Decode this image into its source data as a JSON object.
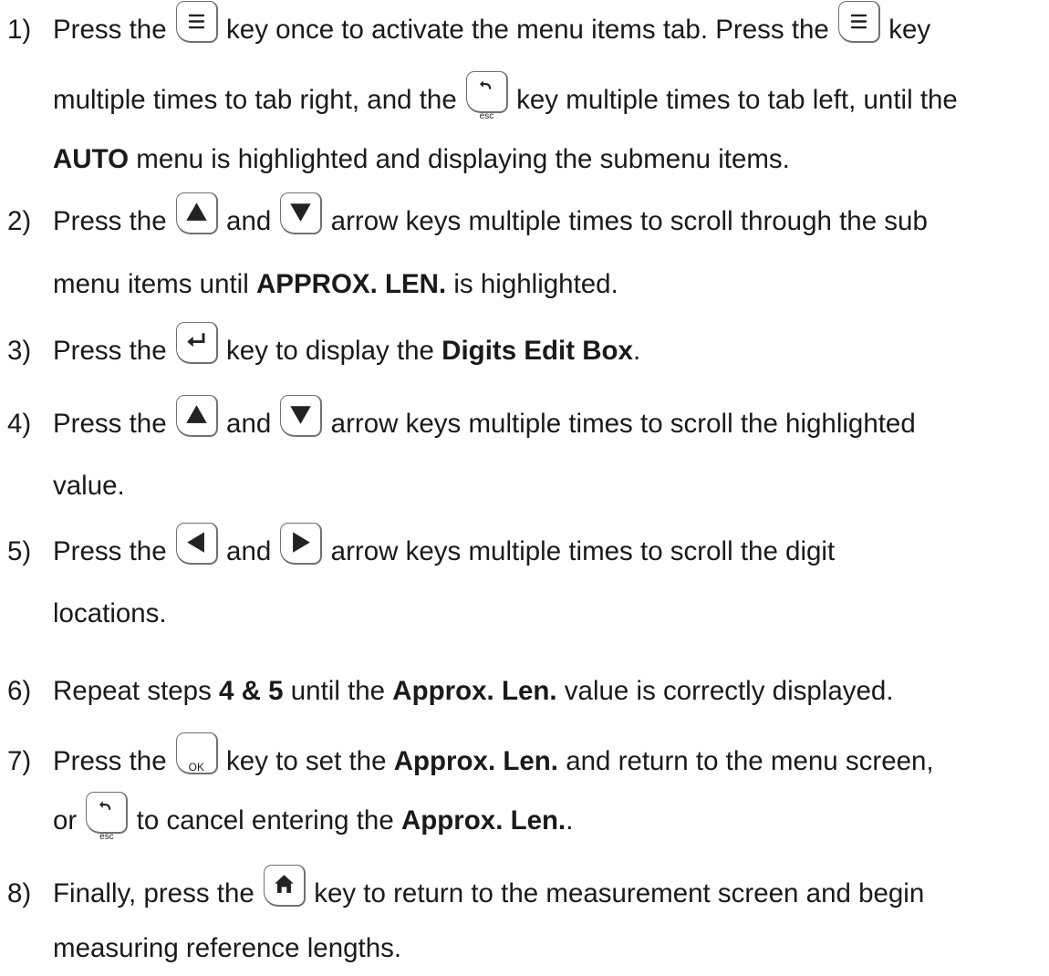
{
  "steps": [
    {
      "num": "1)",
      "line1_a": "Press the",
      "line1_b": "key once to activate the menu items tab.  Press the",
      "line1_c": "key",
      "line2_a": "multiple times to tab right, and the",
      "line2_b": "key multiple times to tab left, until the",
      "line3_bold": "AUTO",
      "line3_rest": "menu is highlighted and displaying the submenu items."
    },
    {
      "num": "2)",
      "line1_a": "Press the",
      "line1_b": "and",
      "line1_c": "arrow keys multiple times to scroll through the sub",
      "line2_a": "menu items until",
      "line2_bold": "APPROX. LEN.",
      "line2_b": "is highlighted."
    },
    {
      "num": "3)",
      "line1_a": "Press the",
      "line1_b": "key to display the",
      "line1_bold": "Digits Edit Box",
      "line1_c": "."
    },
    {
      "num": "4)",
      "line1_a": "Press the",
      "line1_b": "and",
      "line1_c": "arrow keys multiple times to scroll the highlighted",
      "line2_a": "value."
    },
    {
      "num": "5)",
      "line1_a": "Press the",
      "line1_b": "and",
      "line1_c": "arrow keys multiple times to scroll the digit",
      "line2_a": "locations."
    },
    {
      "num": "6)",
      "line1_a": "Repeat steps",
      "line1_bold1": "4 & 5",
      "line1_b": "until the",
      "line1_bold2": "Approx. Len.",
      "line1_c": "value is correctly displayed."
    },
    {
      "num": "7)",
      "line1_a": "Press the",
      "line1_b": "key to set the",
      "line1_bold": "Approx. Len.",
      "line1_c": "and return to the menu screen,",
      "line2_a": "or",
      "line2_b": "to cancel entering the",
      "line2_bold": "Approx. Len.",
      "line2_c": "."
    },
    {
      "num": "8)",
      "line1_a": "Finally, press the",
      "line1_b": "key to return to the measurement screen and begin",
      "line2_a": "measuring reference lengths."
    }
  ],
  "keys": {
    "menu": "menu-icon",
    "esc": "esc",
    "up": "up-arrow-icon",
    "down": "down-arrow-icon",
    "left": "left-arrow-icon",
    "right": "right-arrow-icon",
    "enter": "enter-icon",
    "ok": "OK",
    "home": "home-icon"
  }
}
